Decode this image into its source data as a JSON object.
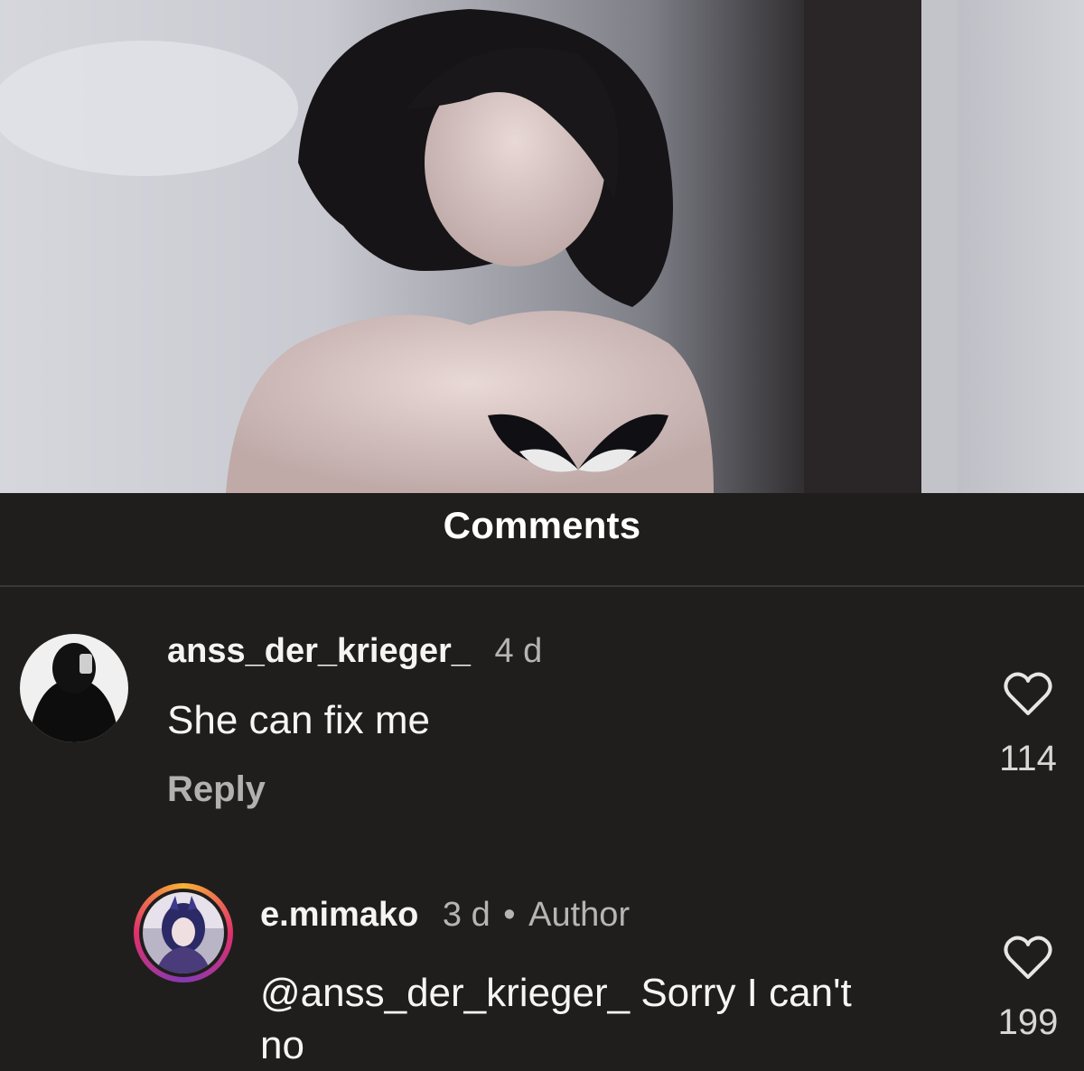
{
  "header": {
    "title": "Comments"
  },
  "comments": [
    {
      "username": "anss_der_krieger_",
      "age": "4 d",
      "text": "She can fix me",
      "reply_label": "Reply",
      "likes": "114",
      "avatar_icon": "user-avatar-icon"
    },
    {
      "username": "e.mimako",
      "age": "3 d",
      "separator": "•",
      "badge": "Author",
      "text_line1": "@anss_der_krieger_ Sorry I can't",
      "text_line2": "no",
      "likes": "199",
      "avatar_icon": "author-avatar-icon",
      "story_ring_colors": [
        "#f9b233",
        "#e1306c",
        "#833ab4"
      ]
    }
  ],
  "icons": {
    "like": "heart-icon"
  }
}
